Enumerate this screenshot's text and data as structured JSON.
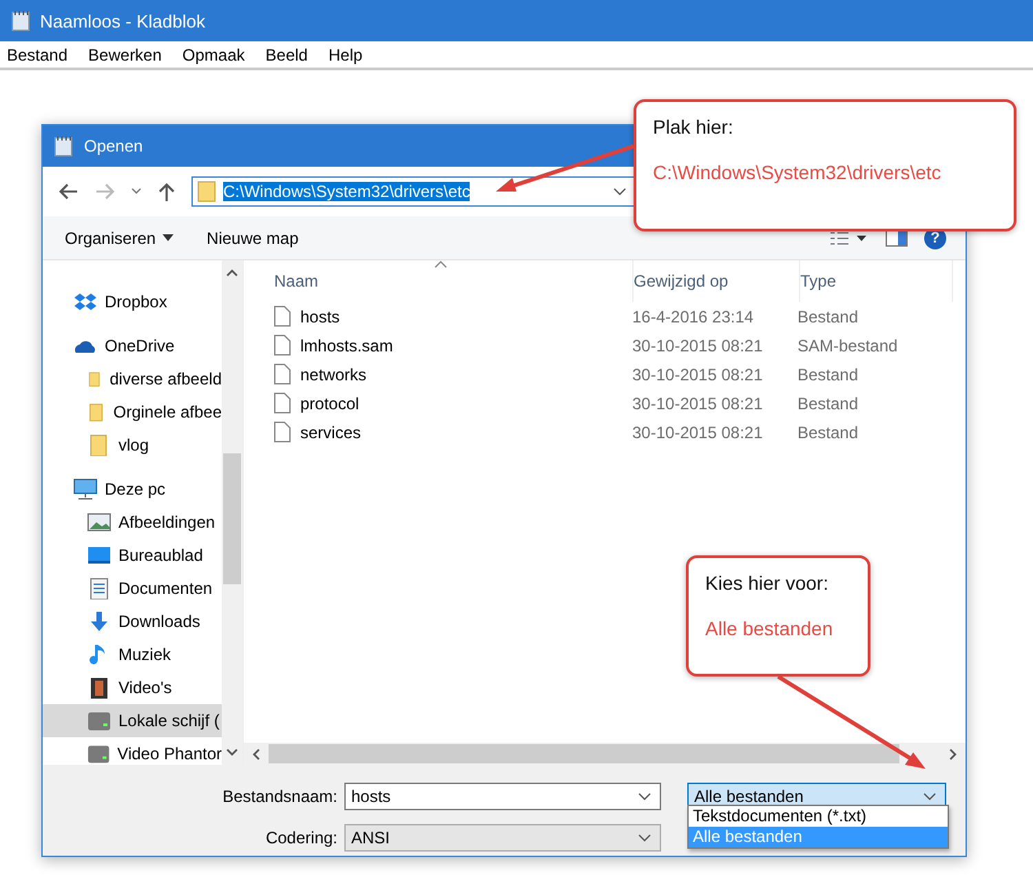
{
  "notepad": {
    "title": "Naamloos - Kladblok",
    "menu": [
      "Bestand",
      "Bewerken",
      "Opmaak",
      "Beeld",
      "Help"
    ]
  },
  "dialog": {
    "title": "Openen",
    "address": {
      "path": "C:\\Windows\\System32\\drivers\\etc"
    },
    "toolbar": {
      "organize": "Organiseren",
      "new_folder": "Nieuwe map",
      "help": "?"
    },
    "nav": [
      {
        "label": "Dropbox",
        "kind": "dropbox",
        "selected": false
      },
      {
        "label": "OneDrive",
        "kind": "cloud",
        "selected": false,
        "children": [
          {
            "label": "diverse afbeeld",
            "kind": "folder",
            "selected": false
          },
          {
            "label": "Orginele afbee",
            "kind": "folder",
            "selected": false
          },
          {
            "label": "vlog",
            "kind": "folder",
            "selected": false
          }
        ]
      },
      {
        "label": "Deze pc",
        "kind": "computer",
        "selected": false,
        "children": [
          {
            "label": "Afbeeldingen",
            "kind": "pictures",
            "selected": false
          },
          {
            "label": "Bureaublad",
            "kind": "desktop",
            "selected": false
          },
          {
            "label": "Documenten",
            "kind": "documents",
            "selected": false
          },
          {
            "label": "Downloads",
            "kind": "downloads",
            "selected": false
          },
          {
            "label": "Muziek",
            "kind": "music",
            "selected": false
          },
          {
            "label": "Video's",
            "kind": "videos",
            "selected": false
          },
          {
            "label": "Lokale schijf (",
            "kind": "drive",
            "selected": true
          },
          {
            "label": "Video Phantor",
            "kind": "drive",
            "selected": false
          }
        ]
      }
    ],
    "columns": [
      "Naam",
      "Gewijzigd op",
      "Type"
    ],
    "files": [
      {
        "name": "hosts",
        "modified": "16-4-2016 23:14",
        "type": "Bestand"
      },
      {
        "name": "lmhosts.sam",
        "modified": "30-10-2015 08:21",
        "type": "SAM-bestand"
      },
      {
        "name": "networks",
        "modified": "30-10-2015 08:21",
        "type": "Bestand"
      },
      {
        "name": "protocol",
        "modified": "30-10-2015 08:21",
        "type": "Bestand"
      },
      {
        "name": "services",
        "modified": "30-10-2015 08:21",
        "type": "Bestand"
      }
    ],
    "filename": {
      "label": "Bestandsnaam:",
      "value": "hosts"
    },
    "encoding": {
      "label": "Codering:",
      "value": "ANSI"
    },
    "filetype": {
      "value": "Alle bestanden",
      "expanded": true,
      "options": [
        {
          "label": "Tekstdocumenten (*.txt)",
          "selected": false
        },
        {
          "label": "Alle bestanden",
          "selected": true
        }
      ]
    }
  },
  "callouts": [
    {
      "title": "Plak hier:",
      "text": "C:\\Windows\\System32\\drivers\\etc"
    },
    {
      "title": "Kies hier voor:",
      "text": "Alle bestanden"
    }
  ]
}
